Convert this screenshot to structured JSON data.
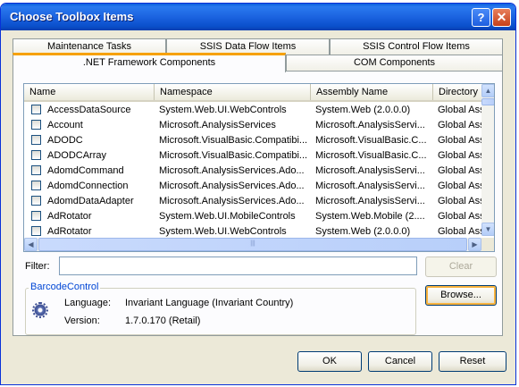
{
  "window": {
    "title": "Choose Toolbox Items",
    "help": "?",
    "close": "✕"
  },
  "tabs": {
    "top": [
      "Maintenance Tasks",
      "SSIS Data Flow Items",
      "SSIS Control Flow Items"
    ],
    "bottom": [
      ".NET Framework Components",
      "COM Components"
    ],
    "active": ".NET Framework Components"
  },
  "list": {
    "columns": [
      "Name",
      "Namespace",
      "Assembly Name",
      "Directory"
    ],
    "rows": [
      {
        "checked": false,
        "name": "AccessDataSource",
        "namespace": "System.Web.UI.WebControls",
        "assembly": "System.Web (2.0.0.0)",
        "directory": "Global Ass"
      },
      {
        "checked": false,
        "name": "Account",
        "namespace": "Microsoft.AnalysisServices",
        "assembly": "Microsoft.AnalysisServi...",
        "directory": "Global Ass"
      },
      {
        "checked": false,
        "name": "ADODC",
        "namespace": "Microsoft.VisualBasic.Compatibi...",
        "assembly": "Microsoft.VisualBasic.C...",
        "directory": "Global Ass"
      },
      {
        "checked": false,
        "name": "ADODCArray",
        "namespace": "Microsoft.VisualBasic.Compatibi...",
        "assembly": "Microsoft.VisualBasic.C...",
        "directory": "Global Ass"
      },
      {
        "checked": false,
        "name": "AdomdCommand",
        "namespace": "Microsoft.AnalysisServices.Ado...",
        "assembly": "Microsoft.AnalysisServi...",
        "directory": "Global Ass"
      },
      {
        "checked": false,
        "name": "AdomdConnection",
        "namespace": "Microsoft.AnalysisServices.Ado...",
        "assembly": "Microsoft.AnalysisServi...",
        "directory": "Global Ass"
      },
      {
        "checked": false,
        "name": "AdomdDataAdapter",
        "namespace": "Microsoft.AnalysisServices.Ado...",
        "assembly": "Microsoft.AnalysisServi...",
        "directory": "Global Ass"
      },
      {
        "checked": false,
        "name": "AdRotator",
        "namespace": "System.Web.UI.MobileControls",
        "assembly": "System.Web.Mobile (2....",
        "directory": "Global Ass"
      },
      {
        "checked": false,
        "name": "AdRotator",
        "namespace": "System.Web.UI.WebControls",
        "assembly": "System.Web (2.0.0.0)",
        "directory": "Global Ass"
      }
    ]
  },
  "filter": {
    "label": "Filter:",
    "value": "",
    "clear": "Clear"
  },
  "details": {
    "group_title": "BarcodeControl",
    "language_label": "Language:",
    "language_value": "Invariant Language (Invariant Country)",
    "version_label": "Version:",
    "version_value": "1.7.0.170 (Retail)",
    "browse": "Browse..."
  },
  "buttons": {
    "ok": "OK",
    "cancel": "Cancel",
    "reset": "Reset"
  },
  "icons": {
    "help": "help-icon",
    "close": "close-icon",
    "component": "gear-icon"
  },
  "colors": {
    "titlebar": "#0a5fdc",
    "accent_tab": "#f6a100",
    "legend": "#0046d5"
  }
}
